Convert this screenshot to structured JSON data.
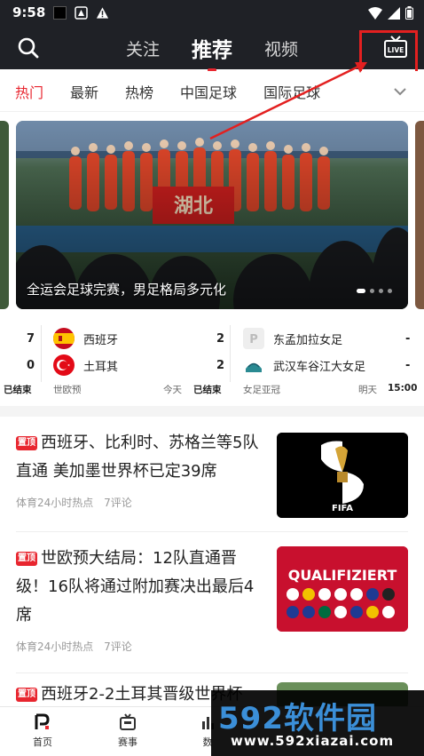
{
  "status_bar": {
    "time": "9:58"
  },
  "header": {
    "tabs": [
      {
        "label": "关注",
        "active": false
      },
      {
        "label": "推荐",
        "active": true
      },
      {
        "label": "视频",
        "active": false
      }
    ],
    "live_label": "LIVE"
  },
  "categories": [
    {
      "label": "热门",
      "active": true
    },
    {
      "label": "最新",
      "active": false
    },
    {
      "label": "热榜",
      "active": false
    },
    {
      "label": "中国足球",
      "active": false
    },
    {
      "label": "国际足球",
      "active": false
    }
  ],
  "banner": {
    "caption": "全运会足球完赛，男足格局多元化",
    "banner_text": "湖北",
    "dots_count": 4,
    "active_dot": 0
  },
  "matches": [
    {
      "partial_left": {
        "score_home": "7",
        "score_away": "0",
        "status": "已结束"
      },
      "home": {
        "name": "西班牙",
        "score": "2"
      },
      "away": {
        "name": "土耳其",
        "score": "2"
      },
      "competition": "世欧预",
      "day": "今天",
      "status": "已结束"
    },
    {
      "home": {
        "name": "东孟加拉女足",
        "score": "-"
      },
      "away": {
        "name": "武汉车谷江大女足",
        "score": "-"
      },
      "competition": "女足亚冠",
      "day": "明天",
      "time": "15:00"
    }
  ],
  "news": [
    {
      "pin": "置顶",
      "title": "西班牙、比利时、苏格兰等5队直通 美加墨世界杯已定39席",
      "source": "体育24小时热点",
      "comments": "7评论",
      "thumb_text": "FIFA"
    },
    {
      "pin": "置顶",
      "title": "世欧预大结局：12队直通晋级！16队将通过附加赛决出最后4席",
      "source": "体育24小时热点",
      "comments": "7评论",
      "thumb_text": "QUALIFIZIERT"
    },
    {
      "pin": "置顶",
      "title": "西班牙2-2土耳其晋级世界杯"
    }
  ],
  "bottom_nav": [
    {
      "label": "首页",
      "active": true,
      "icon": "home-icon"
    },
    {
      "label": "赛事",
      "active": false,
      "icon": "tv-icon"
    },
    {
      "label": "数",
      "active": false,
      "icon": "data-icon"
    }
  ],
  "watermark": {
    "big": "592软件园",
    "small": "www.592xiazai.com"
  }
}
